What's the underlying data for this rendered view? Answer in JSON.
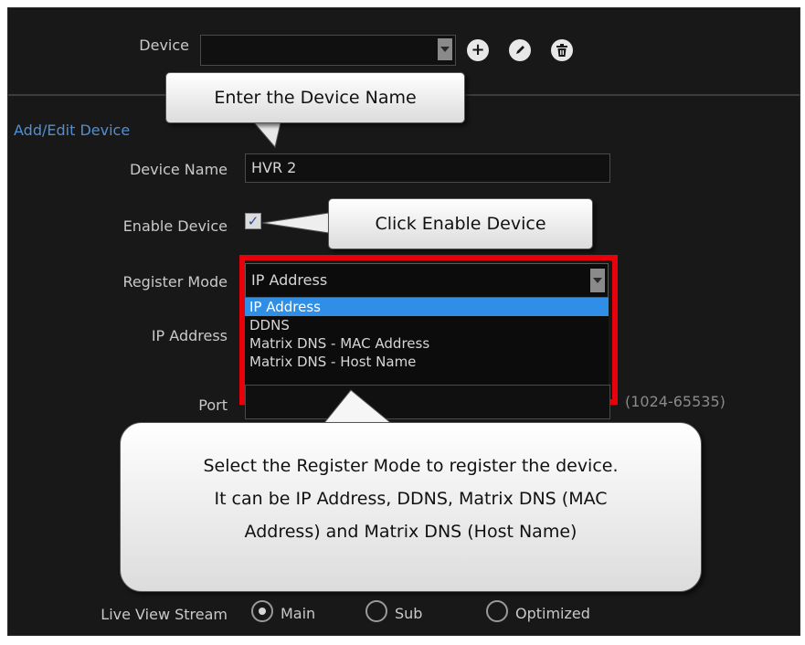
{
  "device_bar": {
    "label": "Device",
    "selected_value": "",
    "icons": [
      "add-icon",
      "edit-icon",
      "delete-icon"
    ]
  },
  "section": {
    "title": "Add/Edit Device"
  },
  "form": {
    "device_name_label": "Device Name",
    "device_name_value": "HVR 2",
    "enable_label": "Enable Device",
    "enable_checked": true,
    "register_mode_label": "Register Mode",
    "register_mode_value": "IP Address",
    "register_mode_options": [
      "IP Address",
      "DDNS",
      "Matrix DNS - MAC Address",
      "Matrix DNS - Host Name"
    ],
    "ip_label": "IP Address",
    "port_label": "Port",
    "port_hint": "(1024-65535)",
    "live_view_label": "Live View Stream",
    "live_view_options": [
      "Main",
      "Sub",
      "Optimized"
    ],
    "live_view_selected": "Main"
  },
  "callouts": {
    "device_name": "Enter the Device Name",
    "enable": "Click Enable Device",
    "register_mode_lines": [
      "Select the Register Mode to register the device.",
      "It can be IP Address, DDNS, Matrix DNS (MAC",
      "Address) and Matrix DNS (Host Name)"
    ]
  },
  "colors": {
    "highlight": "#e8000b",
    "selected_option": "#2f8fe6",
    "section_title": "#4f8fd6"
  }
}
